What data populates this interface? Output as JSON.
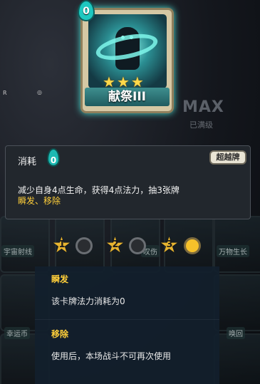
{
  "background": {
    "max_label": "MAX",
    "max_sub": "已满级",
    "tile_labels": [
      "宇宙射线",
      "万物生长",
      "幸运币",
      "唤回",
      "叹伤"
    ],
    "small_glyphs": [
      "R",
      "◎"
    ]
  },
  "card": {
    "name": "献祭III",
    "cost": "0",
    "stars": 3,
    "accent_color": "#4fe0d4",
    "art_icon": "sacrifice-spirit-art"
  },
  "panel": {
    "type_label": "消耗",
    "cost": "0",
    "ultra_button": "超越牌",
    "description": "减少自身4点生命，获得4点法力，抽3张牌",
    "keywords": "瞬发、移除"
  },
  "levels": {
    "items": [
      {
        "label": "1",
        "unlocked": false
      },
      {
        "label": "2",
        "unlocked": false
      },
      {
        "label": "3",
        "unlocked": true
      }
    ]
  },
  "tooltip": {
    "entries": [
      {
        "title": "瞬发",
        "desc": "该卡牌法力消耗为0"
      },
      {
        "title": "移除",
        "desc": "使用后，本场战斗不可再次使用"
      }
    ]
  },
  "colors": {
    "keyword_yellow": "#ffcf3a",
    "star_gold": "#e8b430",
    "teal": "#1ec8c0"
  }
}
